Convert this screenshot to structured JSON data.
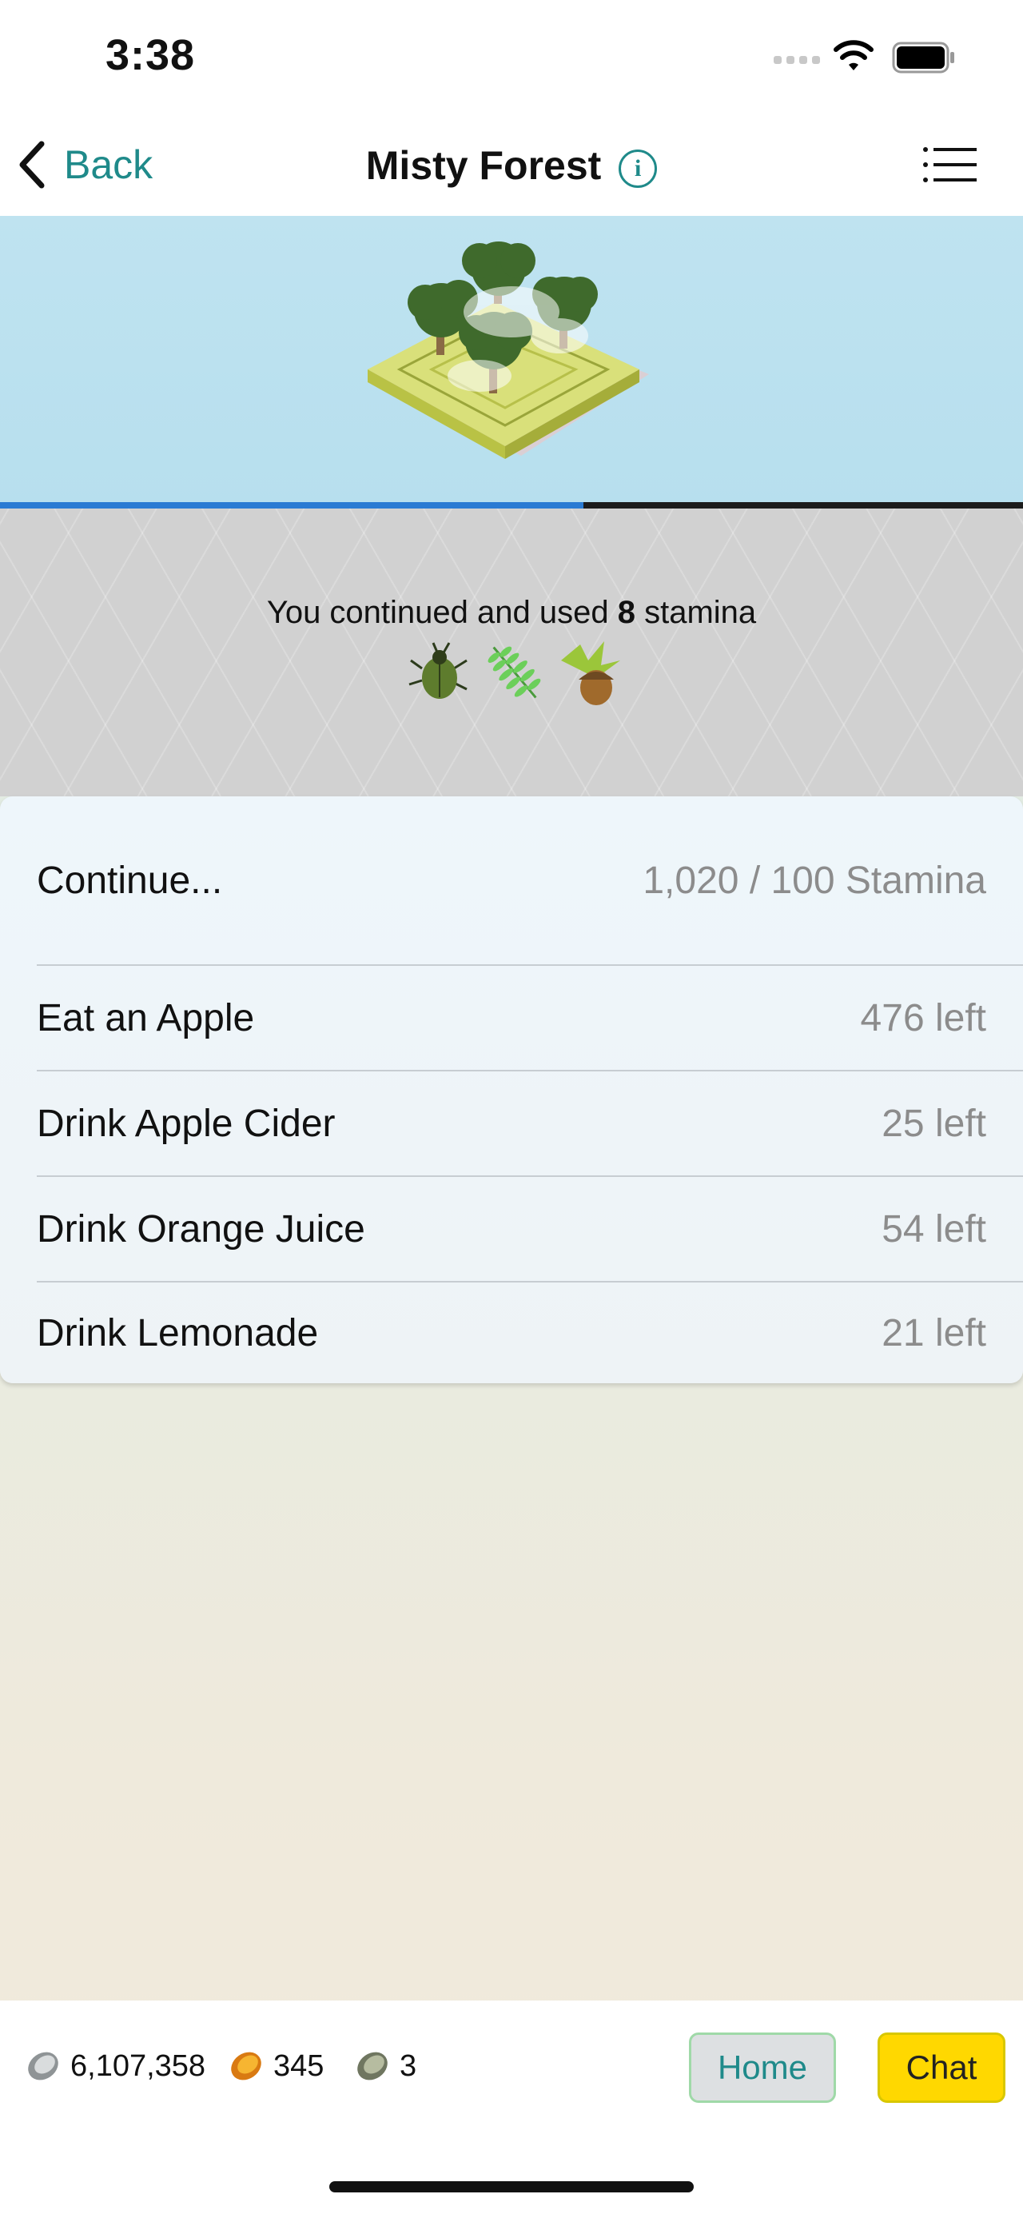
{
  "status_bar": {
    "time": "3:38"
  },
  "nav": {
    "back_label": "Back",
    "title": "Misty Forest",
    "info_glyph": "i",
    "info_icon": "info-icon",
    "menu_icon": "list-menu-icon"
  },
  "hero": {
    "scene": "isometric forest tile with trees and mist",
    "progress": 0.57,
    "progress_color": "#2a7bd3"
  },
  "message": {
    "prefix": "You continued and used",
    "amount": "8",
    "suffix": "stamina",
    "loot_icons": [
      "beetle-icon",
      "fern-leaf-icon",
      "acorn-icon"
    ]
  },
  "actions": {
    "continue": {
      "label": "Continue...",
      "value": "1,020  / 100 Stamina"
    },
    "items": [
      {
        "label": "Eat an Apple",
        "value": "476 left"
      },
      {
        "label": "Drink Apple Cider",
        "value": "25 left"
      },
      {
        "label": "Drink Orange Juice",
        "value": "54 left"
      },
      {
        "label": "Drink Lemonade",
        "value": "21 left"
      }
    ]
  },
  "currencies": [
    {
      "icon": "silver-coin-icon",
      "value": "6,107,358"
    },
    {
      "icon": "gold-coin-icon",
      "value": "345"
    },
    {
      "icon": "jade-coin-icon",
      "value": "3"
    }
  ],
  "buttons": {
    "home": "Home",
    "chat": "Chat"
  },
  "colors": {
    "accent": "#1f8a8a",
    "chat": "#ffd800",
    "home_border": "#9fd9a8"
  }
}
